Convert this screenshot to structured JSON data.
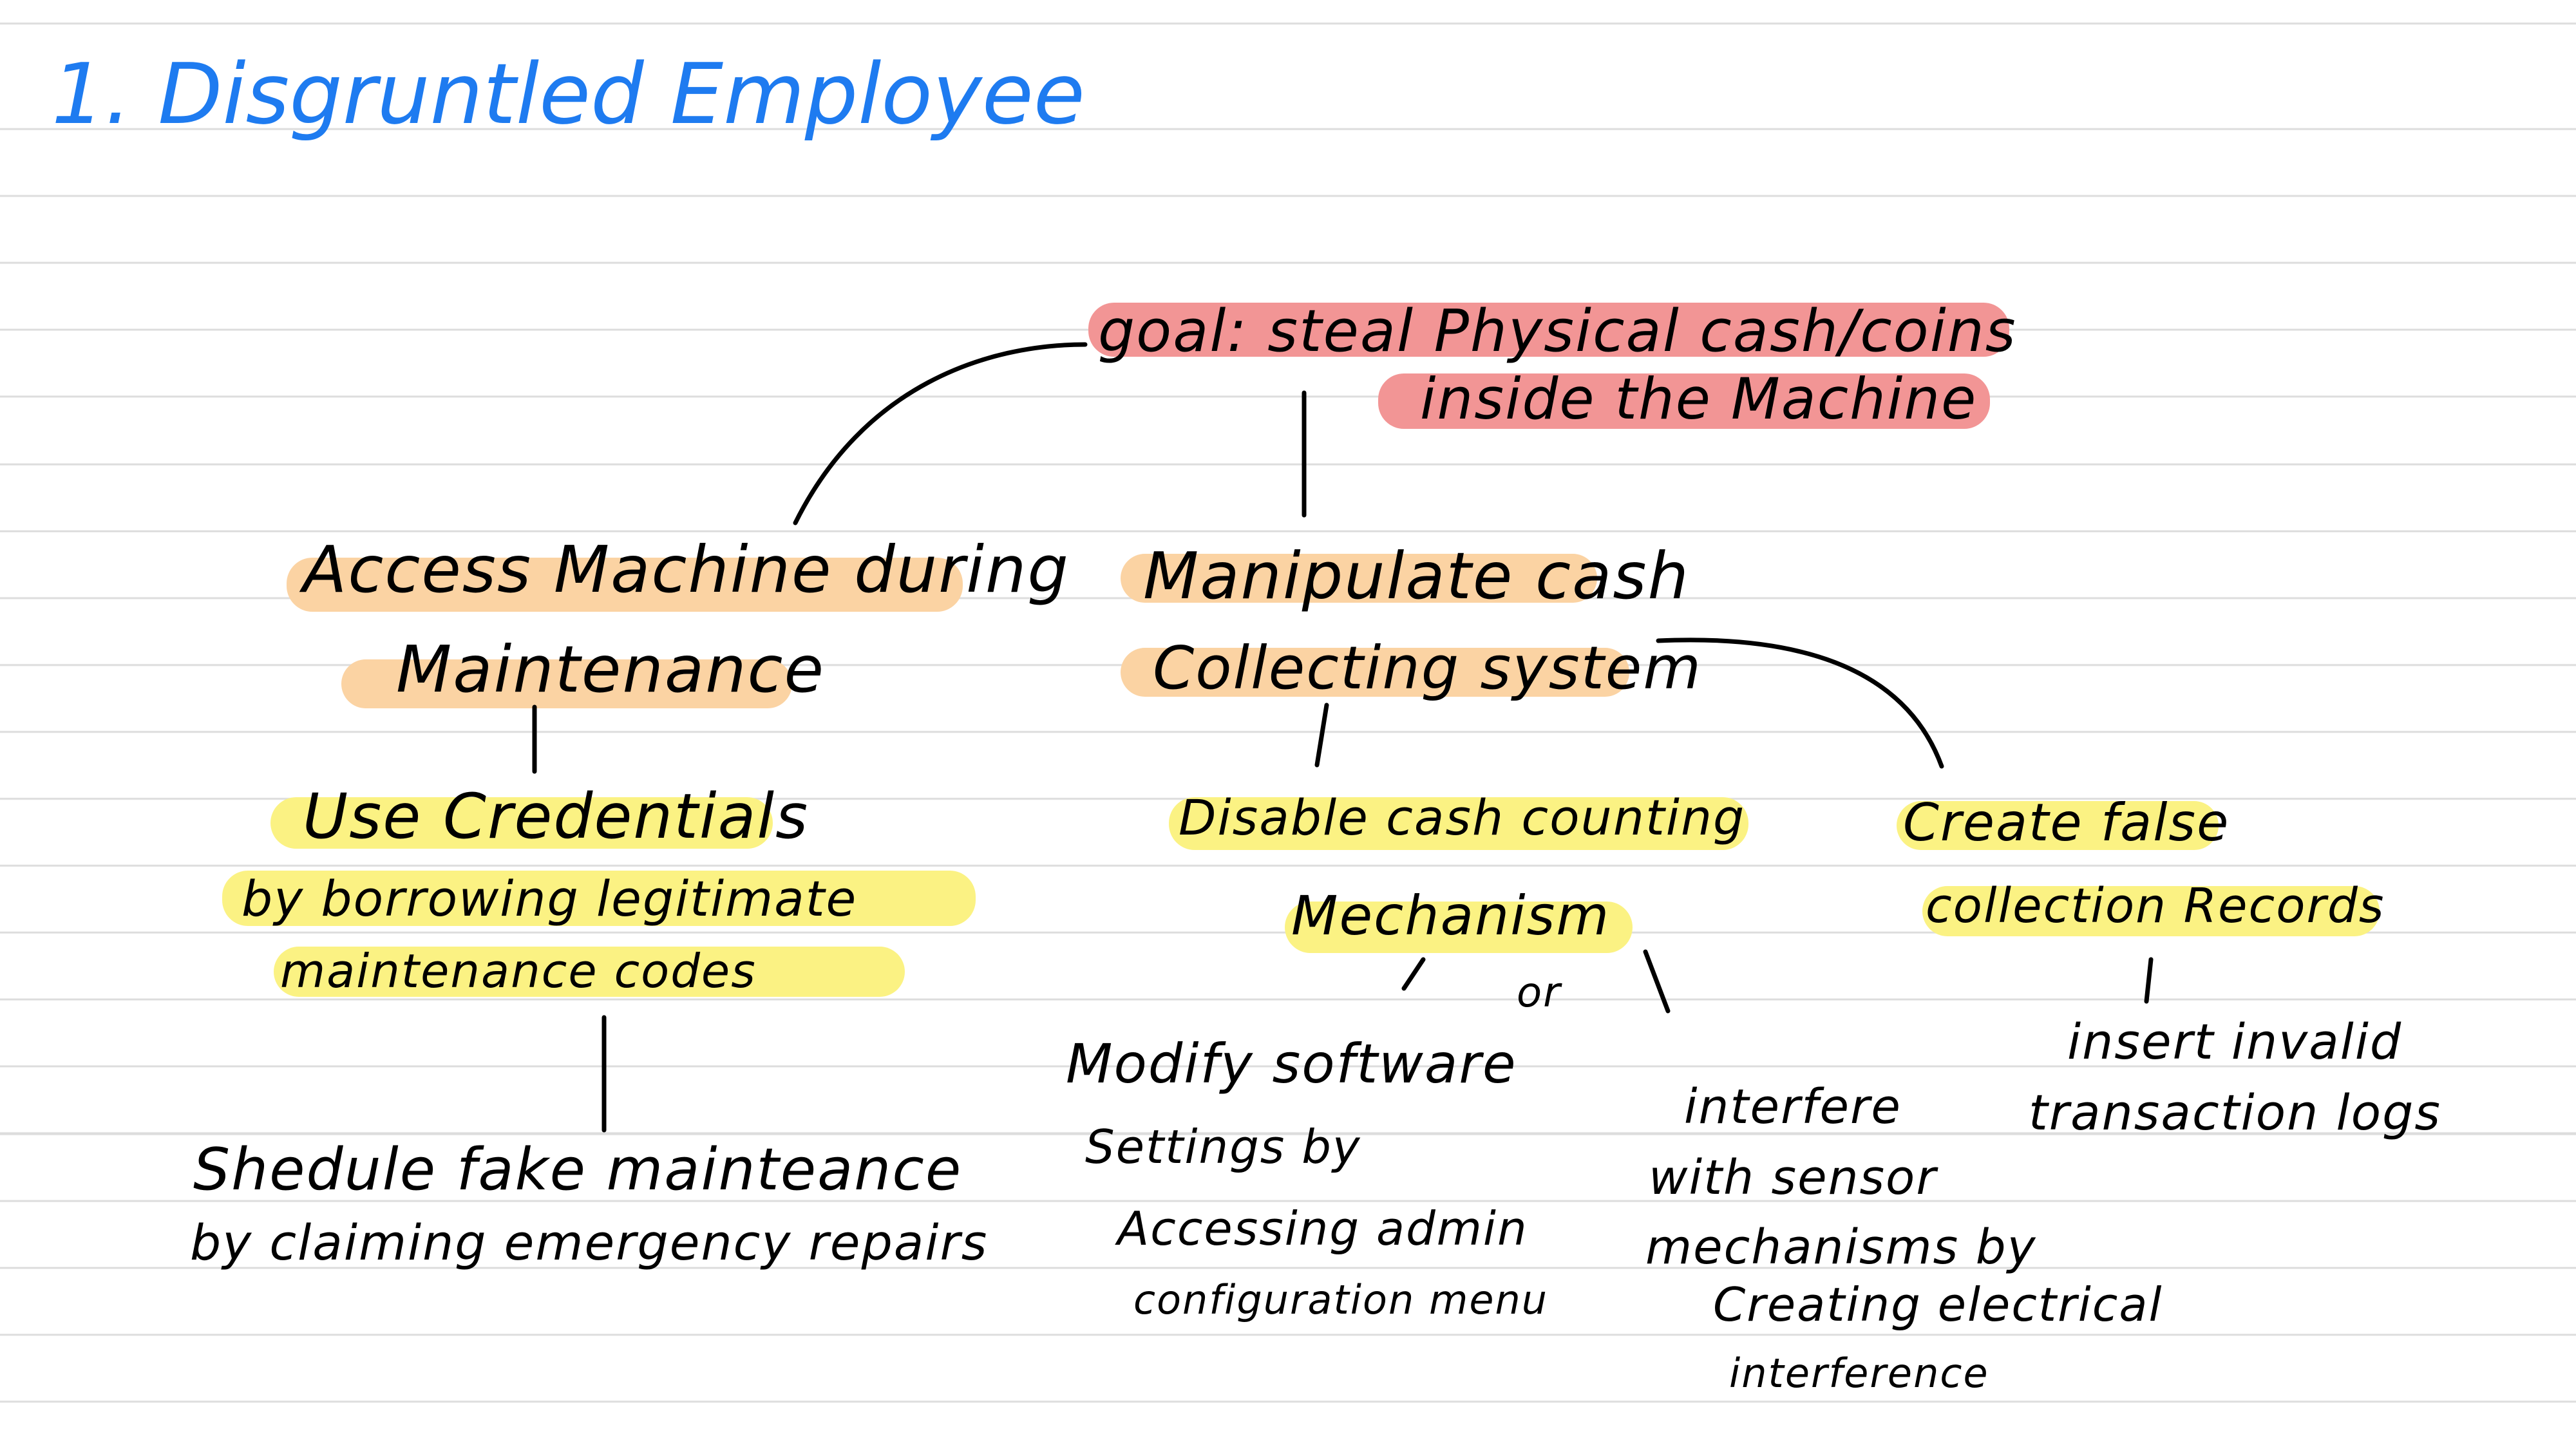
{
  "colors": {
    "ink": "#000000",
    "title": "#1e7bf0",
    "goal_highlight": "#f29595",
    "level1_highlight": "#fbd3a3",
    "level2_highlight": "#fbf283",
    "ruled_line": "#dcdcdc"
  },
  "title": "1. Disgruntled Employee",
  "goal": {
    "line1": "goal: steal Physical cash/coins",
    "line2": "inside the Machine"
  },
  "access": {
    "line1": "Access Machine during",
    "line2": "Maintenance",
    "child": {
      "line1": "Use Credentials",
      "line2": "by borrowing legitimate",
      "line3": "maintenance codes"
    },
    "leaf": {
      "line1": "Shedule fake mainteance",
      "line2": "by claiming emergency repairs"
    }
  },
  "manipulate": {
    "line1": "Manipulate cash",
    "line2": "Collecting system",
    "disable": {
      "line1": "Disable cash counting",
      "line2": "Mechanism",
      "or": "or",
      "modify": {
        "line1": "Modify software",
        "line2": "Settings by",
        "line3": "Accessing admin",
        "line4": "configuration menu"
      },
      "interfere": {
        "line1": "interfere",
        "line2": "with sensor",
        "line3": "mechanisms by",
        "line4": "Creating electrical",
        "line5": "interference"
      }
    },
    "false_records": {
      "line1": "Create false",
      "line2": "collection Records",
      "insert": {
        "line1": "insert invalid",
        "line2": "transaction logs"
      }
    }
  }
}
